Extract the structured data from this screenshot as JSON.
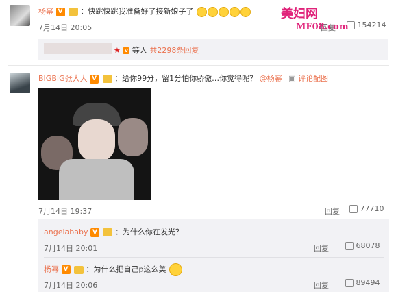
{
  "watermark": {
    "title": "美妇网",
    "sub": "MF08.com"
  },
  "comments": [
    {
      "user": "杨幂",
      "text": "：快跳快跳我准备好了接新娘子了",
      "time": "7月14日 20:05",
      "reply": "回复",
      "likes": "154214",
      "summary": {
        "suffix": "等人",
        "link": "共2298条回复"
      }
    },
    {
      "user": "BIGBIG张大大",
      "text": "：给你99分，留1分怕你骄傲…你觉得呢？",
      "mention": "@杨幂",
      "pic_label": "评论配图",
      "time": "7月14日 19:37",
      "reply": "回复",
      "likes": "77710"
    }
  ],
  "replies": [
    {
      "user": "angelababy",
      "text": "：为什么你在发光？",
      "time": "7月14日 20:01",
      "reply": "回复",
      "likes": "68078"
    },
    {
      "user": "杨幂",
      "text": "：为什么把自己p这么美",
      "time": "7月14日 20:06",
      "reply": "回复",
      "likes": "89494"
    }
  ],
  "colors": {
    "accent": "#eb7350",
    "link": "#eb7350",
    "watermark": "#e0237a"
  }
}
